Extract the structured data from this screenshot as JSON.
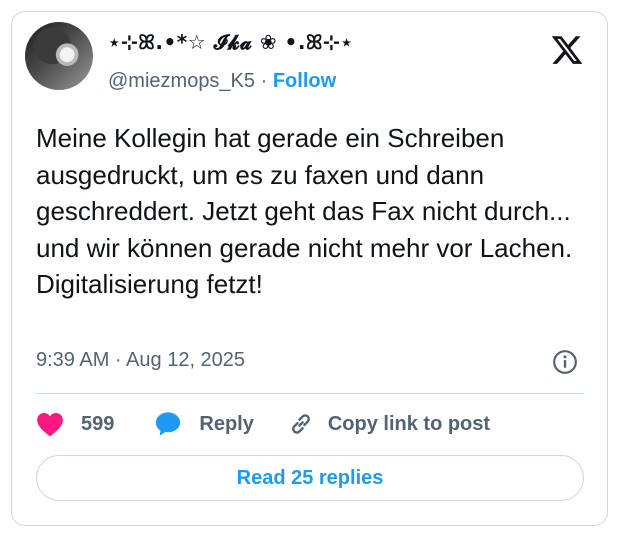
{
  "author": {
    "display_name": "⋆⊹ꕤ.•*☆ 𝓘𝓴𝓪 ❀ •.ꕤ⊹⋆",
    "handle": "@miezmops_K5",
    "separator": "·",
    "follow_label": "Follow"
  },
  "tweet": {
    "text": "Meine Kollegin hat gerade ein Schreiben ausgedruckt, um es zu faxen und dann geschreddert. Jetzt geht das Fax nicht durch... und wir können gerade nicht mehr vor Lachen.\nDigitalisierung fetzt!",
    "timestamp": "9:39 AM · Aug 12, 2025"
  },
  "actions": {
    "like_count": "599",
    "reply_label": "Reply",
    "copy_label": "Copy link to post"
  },
  "footer": {
    "read_replies_label": "Read 25 replies"
  },
  "icons": {
    "logo": "x-logo-icon",
    "info": "info-icon",
    "like": "heart-icon",
    "reply": "speech-bubble-icon",
    "copy": "link-icon"
  },
  "colors": {
    "accent": "#1d9bf0",
    "like": "#f91880",
    "muted": "#536471",
    "border": "#cfd9de"
  }
}
